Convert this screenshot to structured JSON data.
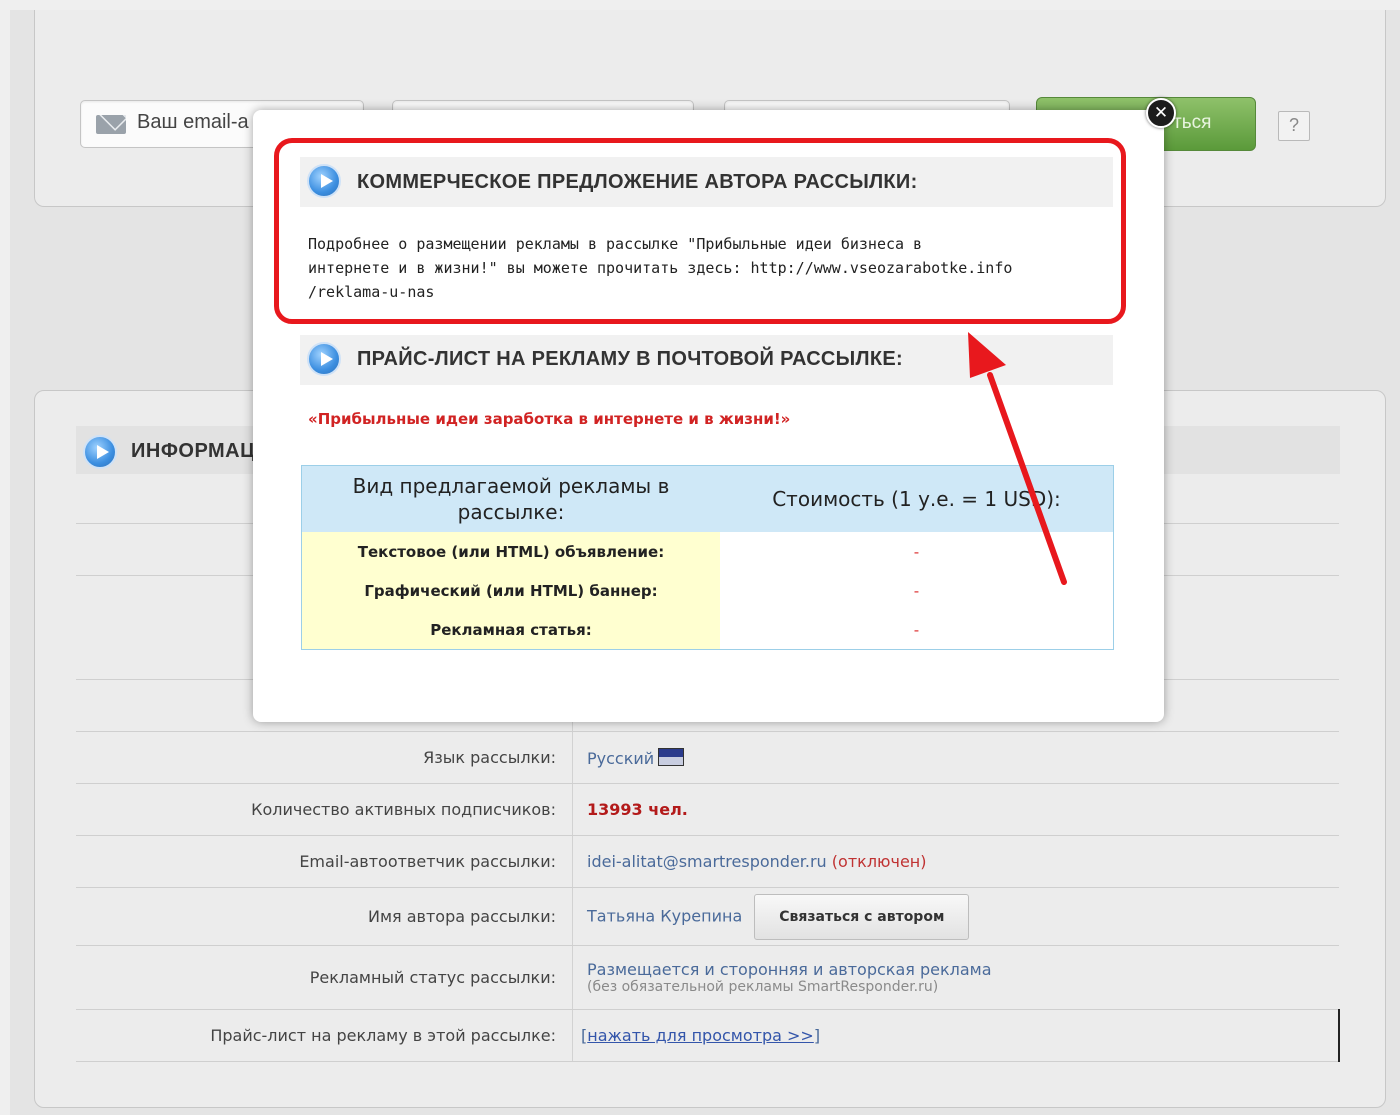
{
  "subscribe": {
    "email_placeholder": "Ваш email-а",
    "submit_label": "ться",
    "help_label": "?"
  },
  "info": {
    "title": "ИНФОРМАЦ",
    "rows": [
      {
        "label": "Язык рассылки:",
        "value": "Русский"
      },
      {
        "label": "Количество активных подписчиков:",
        "value": "13993 чел."
      },
      {
        "label": "Email-автоответчик рассылки:",
        "value": "idei-alitat@smartresponder.ru",
        "extra": "(отключен)"
      },
      {
        "label": "Имя автора рассылки:",
        "value": "Татьяна Курепина",
        "button": "Связаться с автором"
      },
      {
        "label": "Рекламный статус рассылки:",
        "value": "Размещается и сторонняя и авторская реклама",
        "note": "(без обязательной рекламы SmartResponder.ru)"
      },
      {
        "label": "Прайс-лист на рекламу в этой рассылке:",
        "value_prefix": "[",
        "link": "нажать для просмотра >>",
        "value_suffix": "]"
      }
    ]
  },
  "modal": {
    "close_label": "✕",
    "offer_title": "КОММЕРЧЕСКОЕ ПРЕДЛОЖЕНИЕ АВТОРА РАССЫЛКИ:",
    "offer_lines": [
      "Подробнее о размещении рекламы в рассылке \"Прибыльные идеи бизнеса в",
      "интернете и в жизни!\" вы можете прочитать здесь: http://www.vseozarabotke.info",
      "/reklama-u-nas"
    ],
    "price_title": "ПРАЙС-ЛИСТ НА РЕКЛАМУ В ПОЧТОВОЙ РАССЫЛКЕ:",
    "promo": "«Прибыльные идеи заработка в интернете и в жизни!»",
    "table_headers": [
      "Вид предлагаемой рекламы в рассылке:",
      "Стоимость (1 у.е. = 1 USD):"
    ],
    "table_rows": [
      {
        "type": "Текстовое (или HTML) объявление:",
        "price": "-"
      },
      {
        "type": "Графический (или HTML) баннер:",
        "price": "-"
      },
      {
        "type": "Рекламная статья:",
        "price": "-"
      }
    ]
  },
  "annotation": {
    "ring_color": "#e8181d",
    "arrow_color": "#e8181d"
  }
}
